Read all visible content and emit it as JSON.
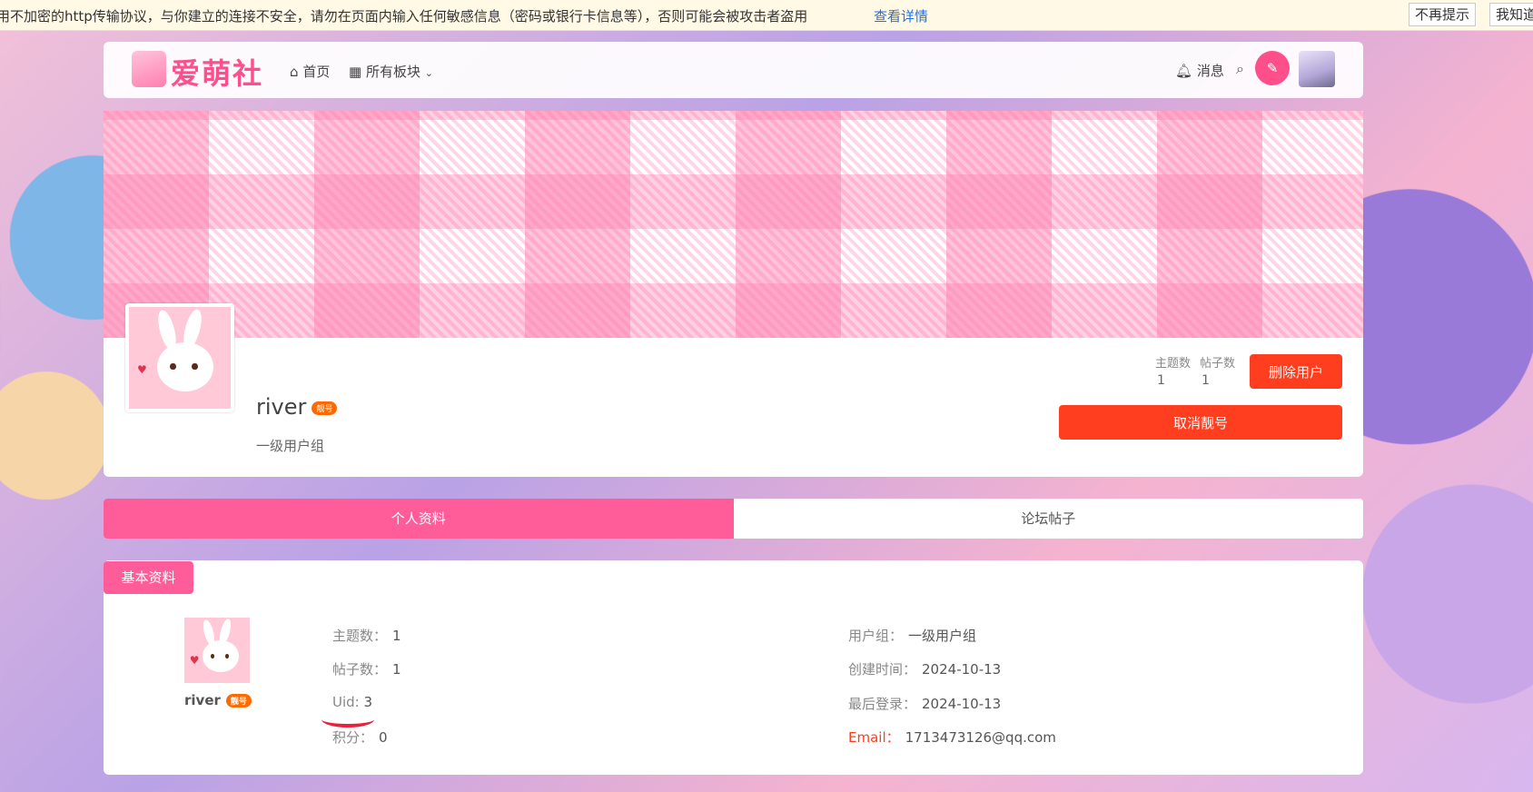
{
  "warning": {
    "message": "用不加密的http传输协议，与你建立的连接不安全，请勿在页面内输入任何敏感信息（密码或银行卡信息等），否则可能会被攻击者盗用",
    "details_link": "查看详情",
    "dont_show": "不再提示",
    "got_it": "我知道"
  },
  "nav": {
    "logo": "爱萌社",
    "home": "首页",
    "all_boards": "所有板块",
    "messages": "消息"
  },
  "profile": {
    "username": "river",
    "badge": "靓号",
    "group": "一级用户组",
    "stats": [
      {
        "label": "主题数",
        "value": "1"
      },
      {
        "label": "帖子数",
        "value": "1"
      }
    ],
    "delete_button": "删除用户",
    "cancel_button": "取消靓号"
  },
  "tabs": [
    {
      "label": "个人资料",
      "active": true
    },
    {
      "label": "论坛帖子",
      "active": false
    }
  ],
  "basic_info": {
    "title": "基本资料",
    "username": "river",
    "badge": "靓号",
    "left": [
      {
        "label": "主题数：",
        "value": "1"
      },
      {
        "label": "帖子数：",
        "value": "1"
      },
      {
        "label": "Uid: ",
        "value": "3"
      },
      {
        "label": "积分：",
        "value": "0"
      }
    ],
    "right": [
      {
        "label": "用户组：",
        "value": "一级用户组"
      },
      {
        "label": "创建时间：",
        "value": "2024-10-13"
      },
      {
        "label": "最后登录：",
        "value": "2024-10-13"
      },
      {
        "label": "Email：",
        "value": "1713473126@qq.com"
      }
    ]
  }
}
